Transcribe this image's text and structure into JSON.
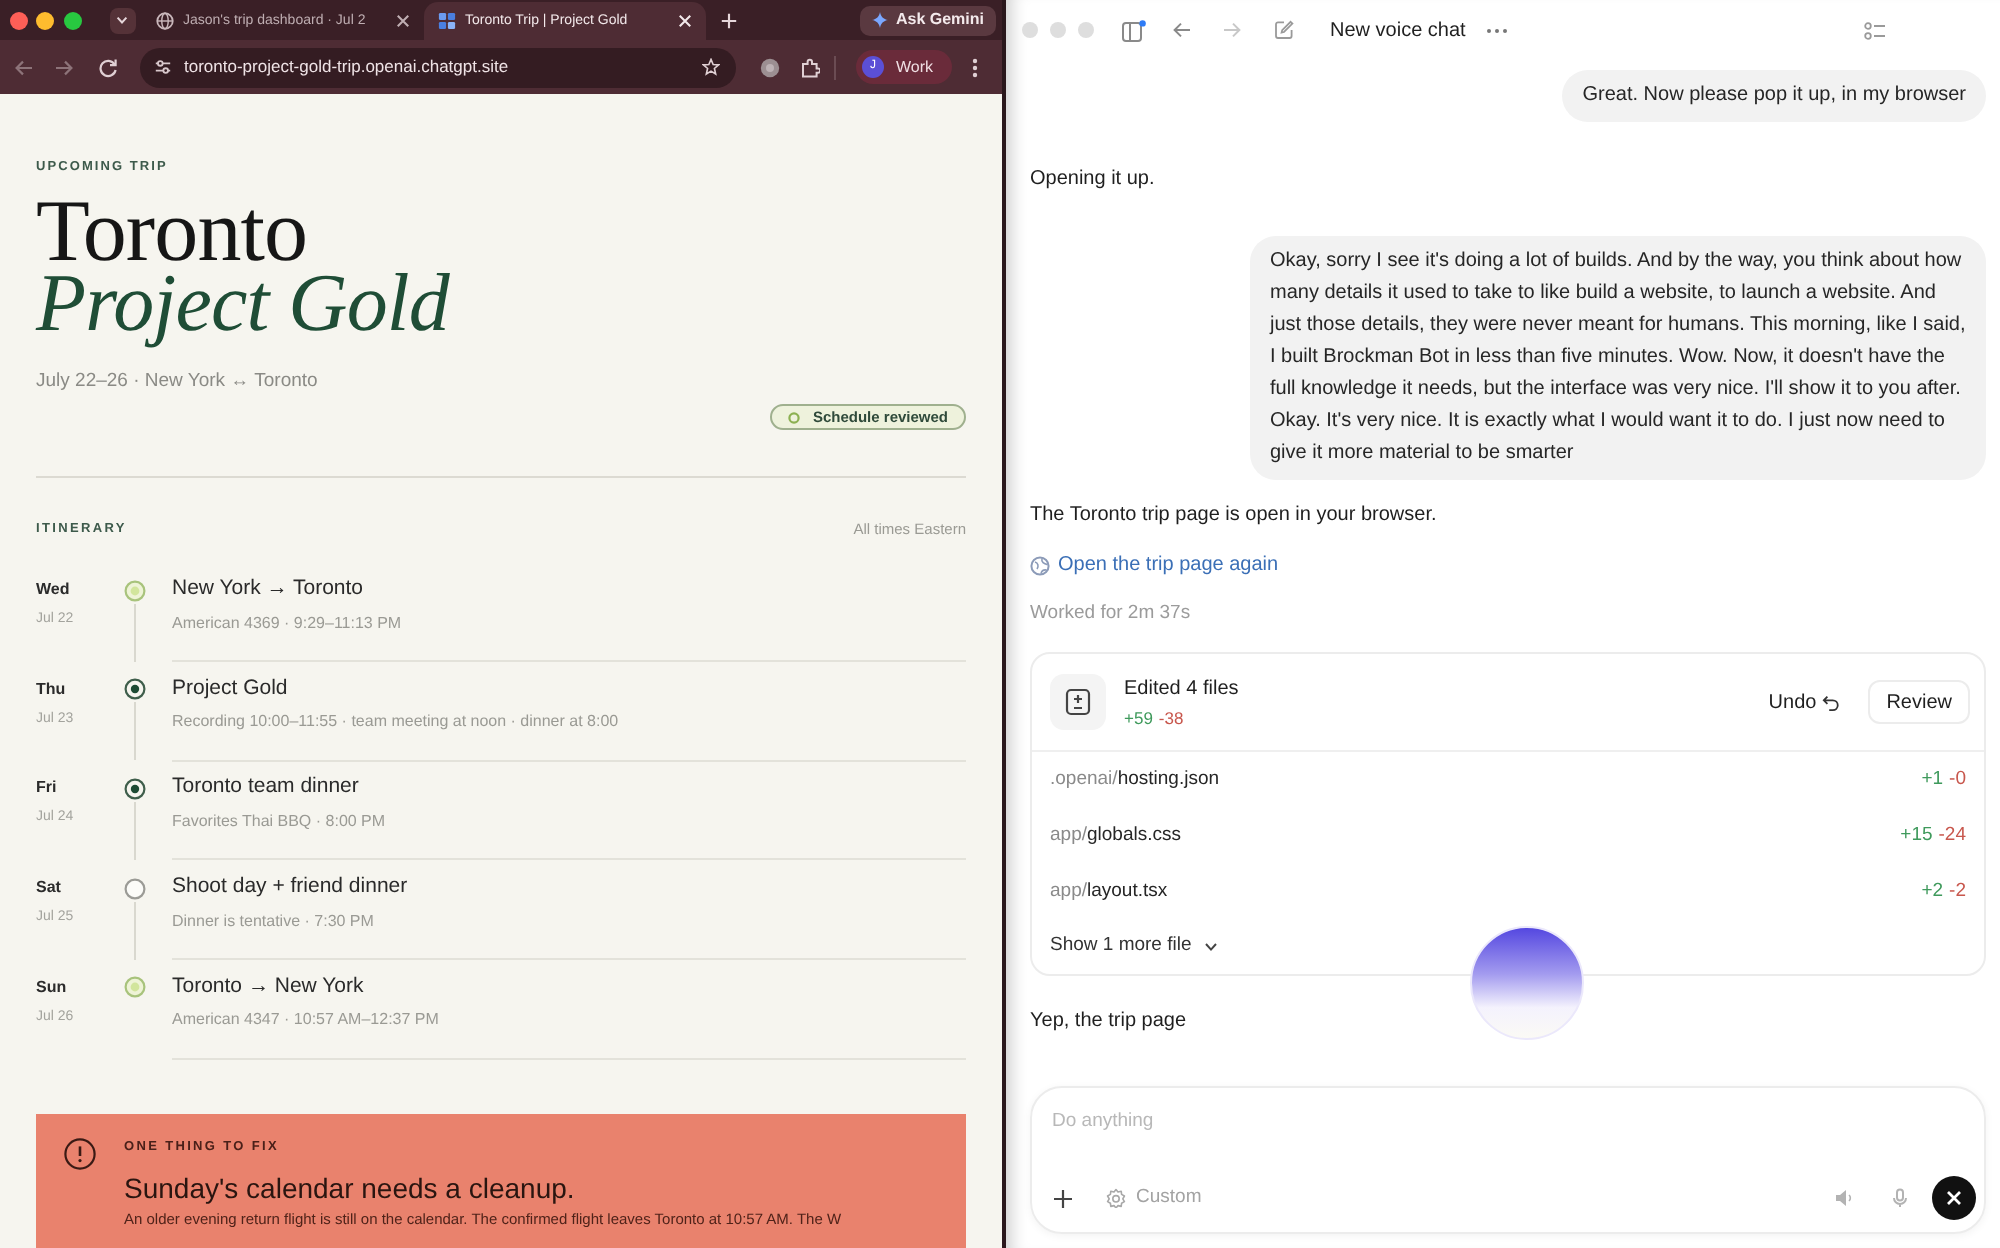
{
  "browser": {
    "tabs": [
      {
        "title": "Jason's trip dashboard · Jul 2",
        "selected": false
      },
      {
        "title": "Toronto Trip | Project Gold",
        "selected": true
      }
    ],
    "assistant_button": "Ask Gemini",
    "url": "toronto-project-gold-trip.openai.chatgpt.site",
    "profile": {
      "initial": "J",
      "label": "Work"
    }
  },
  "trip_page": {
    "eyebrow": "UPCOMING TRIP",
    "title": "Toronto",
    "subtitle": "Project Gold",
    "summary": "July 22–26 · New York ↔ Toronto",
    "status": "Schedule reviewed",
    "itinerary": {
      "heading": "ITINERARY",
      "note": "All times Eastern",
      "days": [
        {
          "day": "Wed",
          "date": "Jul 22",
          "title": "New York → Toronto",
          "detail": "American 4369 · 9:29–11:13 PM",
          "kind": "flight"
        },
        {
          "day": "Thu",
          "date": "Jul 23",
          "title": "Project Gold",
          "detail": "Recording 10:00–11:55 · team meeting at noon · dinner at 8:00",
          "kind": "event"
        },
        {
          "day": "Fri",
          "date": "Jul 24",
          "title": "Toronto team dinner",
          "detail": "Favorites Thai BBQ · 8:00 PM",
          "kind": "event"
        },
        {
          "day": "Sat",
          "date": "Jul 25",
          "title": "Shoot day + friend dinner",
          "detail": "Dinner is tentative · 7:30 PM",
          "kind": "tentative"
        },
        {
          "day": "Sun",
          "date": "Jul 26",
          "title": "Toronto → New York",
          "detail": "American 4347 · 10:57 AM–12:37 PM",
          "kind": "flight"
        }
      ]
    },
    "alert": {
      "eyebrow": "ONE THING TO FIX",
      "title": "Sunday's calendar needs a cleanup.",
      "body": "An older evening return flight is still on the calendar. The confirmed flight leaves Toronto at 10:57 AM. The W"
    }
  },
  "chat": {
    "title": "New voice chat",
    "thread": [
      {
        "kind": "user",
        "text": "Great. Now please pop it up, in my browser"
      },
      {
        "kind": "assistant",
        "text": "Opening it up."
      },
      {
        "kind": "user",
        "text": "Okay, sorry I see it's doing a lot of builds. And by the way, you think about how many details it used to take to like build a website, to launch a website. And just those details, they were never meant for humans. This morning, like I said, I built Brockman Bot in less than five minutes. Wow. Now, it doesn't have the full knowledge it needs, but the interface was very nice. I'll show it to you after. Okay. It's very nice. It is exactly what I would want it to do. I just now need to give it more material to be smarter"
      },
      {
        "kind": "assistant",
        "text": "The Toronto trip page is open in your browser."
      },
      {
        "kind": "link",
        "text": "Open the trip page again"
      },
      {
        "kind": "note",
        "text": "Worked for 2m 37s"
      },
      {
        "kind": "changes",
        "title": "Edited 4 files",
        "added": "+59",
        "removed": "-38",
        "undo": "Undo",
        "review": "Review",
        "files": [
          {
            "path": ".openai/**hosting.json**",
            "added": "+1",
            "removed": "-0"
          },
          {
            "path": "app/**globals.css**",
            "added": "+15",
            "removed": "-24"
          },
          {
            "path": "app/**layout.tsx**",
            "added": "+2",
            "removed": "-2"
          }
        ],
        "more": "Show 1 more file"
      },
      {
        "kind": "assistant",
        "text": "Yep, the trip page"
      }
    ],
    "composer": {
      "placeholder": "Do anything",
      "mode": "Custom"
    }
  }
}
